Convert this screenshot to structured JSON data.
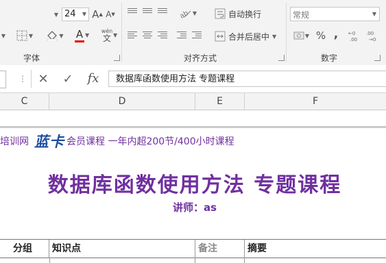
{
  "ribbon": {
    "font_group_label": "字体",
    "font_size": "24",
    "grow_font_label": "A",
    "shrink_font_label": "A",
    "font_color_label": "A",
    "font_color_bar": "#e00000",
    "phonetic_label": "wén",
    "phonetic_char": "文",
    "align_group_label": "对齐方式",
    "wrap_text_label": "自动换行",
    "merge_center_label": "合并后居中",
    "number_group_label": "数字",
    "number_format": "常规",
    "percent_label": "%",
    "comma_label": ","
  },
  "formula_bar": {
    "cancel_glyph": "✕",
    "enter_glyph": "✓",
    "fx_label": "fx",
    "content": "数据库函数使用方法  专题课程"
  },
  "columns": [
    "C",
    "D",
    "E",
    "F"
  ],
  "sheet": {
    "promo_left": "培训网",
    "brand": "蓝卡",
    "promo_right": "会员课程 一年内超200节/400小时课程",
    "title": "数据库函数使用方法  专题课程",
    "lecturer": "讲师：as",
    "headers": [
      "分组",
      "知识点",
      "备注",
      "摘要"
    ]
  },
  "colors": {
    "accent_purple": "#7030a0",
    "brand_blue": "#1f4e9c",
    "ribbon_bg": "#f3f3f3"
  }
}
